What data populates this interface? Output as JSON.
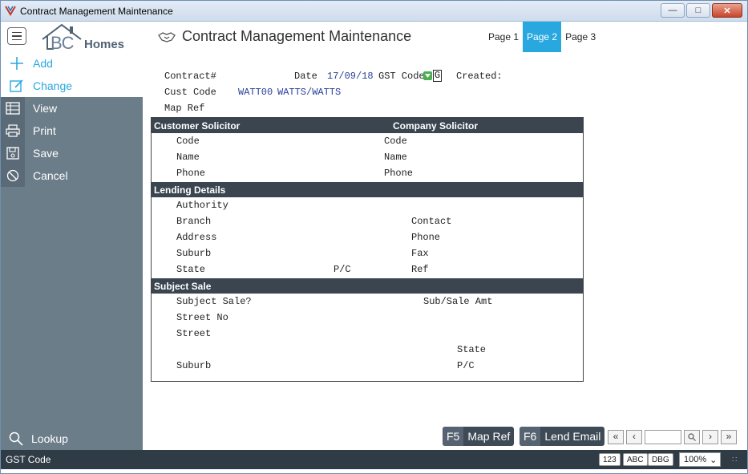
{
  "window": {
    "title": "Contract Management Maintenance"
  },
  "header": {
    "logo_bc": "BC",
    "logo_homes": "Homes",
    "page_title": "Contract Management Maintenance",
    "tabs": [
      {
        "label": "Page 1",
        "active": false
      },
      {
        "label": "Page 2",
        "active": true
      },
      {
        "label": "Page 3",
        "active": false
      }
    ]
  },
  "sidebar": {
    "items": [
      {
        "label": "Add",
        "icon": "plus-icon"
      },
      {
        "label": "Change",
        "icon": "edit-icon"
      },
      {
        "label": "View",
        "icon": "table-icon"
      },
      {
        "label": "Print",
        "icon": "printer-icon"
      },
      {
        "label": "Save",
        "icon": "save-icon"
      },
      {
        "label": "Cancel",
        "icon": "cancel-icon"
      }
    ],
    "lookup": "Lookup"
  },
  "form": {
    "contract_label": "Contract#",
    "date_label": "Date",
    "date_value": "17/09/18",
    "gst_label": "GST Code",
    "gst_value": "G",
    "created_label": "Created:",
    "cust_code_label": "Cust Code",
    "cust_code_value": "WATT00",
    "cust_name_value": "WATTS/WATTS",
    "map_ref_label": "Map Ref"
  },
  "sections": {
    "customer_solicitor": "Customer Solicitor",
    "company_solicitor": "Company Solicitor",
    "lending_details": "Lending Details",
    "subject_sale": "Subject Sale"
  },
  "solicitor": {
    "code": "Code",
    "name": "Name",
    "phone": "Phone"
  },
  "lending": {
    "authority": "Authority",
    "branch": "Branch",
    "address": "Address",
    "suburb": "Suburb",
    "state": "State",
    "pc": "P/C",
    "contact": "Contact",
    "phone": "Phone",
    "fax": "Fax",
    "ref": "Ref"
  },
  "subject": {
    "subject_sale": "Subject Sale?",
    "sub_sale_amt": "Sub/Sale Amt",
    "street_no": "Street No",
    "street": "Street",
    "state": "State",
    "suburb": "Suburb",
    "pc": "P/C"
  },
  "fkeys": [
    {
      "key": "F5",
      "label": "Map Ref"
    },
    {
      "key": "F6",
      "label": "Lend Email"
    }
  ],
  "status": {
    "text": "GST Code",
    "chips": [
      "123",
      "ABC",
      "DBG"
    ],
    "zoom": "100%"
  },
  "colors": {
    "accent": "#29a8e0",
    "sidebar": "#6c7d8a",
    "section_header": "#3a4550",
    "value_text": "#2a3f9a"
  }
}
